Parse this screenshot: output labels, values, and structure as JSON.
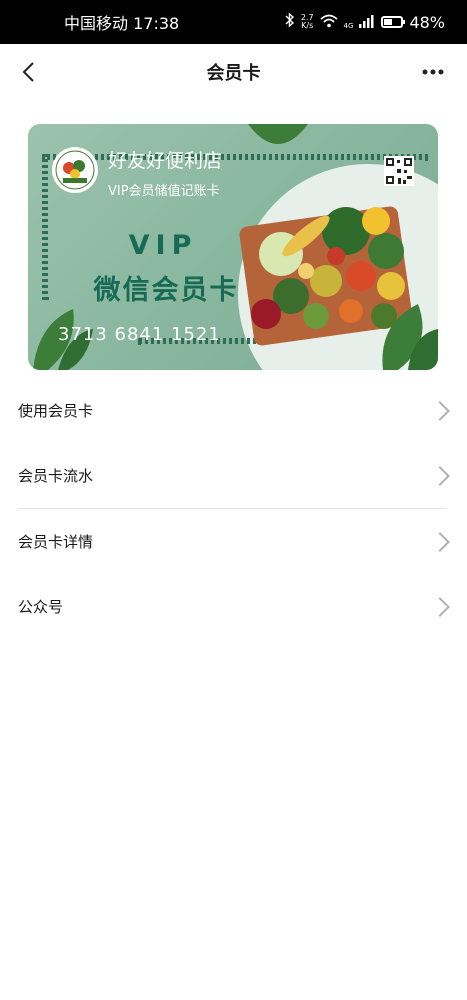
{
  "status_bar": {
    "carrier_time": "中国移动 17:38",
    "speed_value": "2.7",
    "speed_unit": "K/s",
    "network": "4G",
    "battery": "48%",
    "battery_level": 0.48
  },
  "nav": {
    "title": "会员卡",
    "back_icon": "back-chevron-icon",
    "more_icon": "more-dots-icon"
  },
  "card": {
    "shop_name": "好友好便利店",
    "subtitle": "VIP会员储值记账卡",
    "vip_text": "VIP",
    "vip_sub": "微信会员卡",
    "card_number": "3713 6841 1521",
    "accent_color": "#176b55",
    "logo_icon": "shop-logo-icon",
    "qr_icon": "qr-code-icon"
  },
  "menu": [
    {
      "label": "使用会员卡"
    },
    {
      "label": "会员卡流水"
    },
    {
      "label": "会员卡详情"
    },
    {
      "label": "公众号"
    }
  ]
}
